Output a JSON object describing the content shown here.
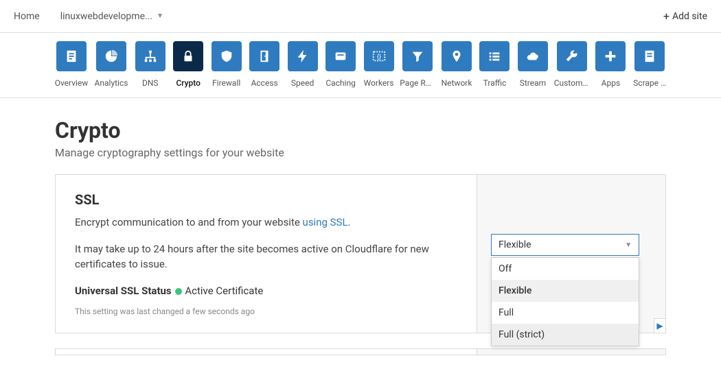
{
  "topbar": {
    "home": "Home",
    "site": "linuxwebdevelopme...",
    "add_site": "Add site"
  },
  "nav": [
    {
      "id": "overview",
      "label": "Overview",
      "icon": "doc"
    },
    {
      "id": "analytics",
      "label": "Analytics",
      "icon": "pie"
    },
    {
      "id": "dns",
      "label": "DNS",
      "icon": "tree"
    },
    {
      "id": "crypto",
      "label": "Crypto",
      "icon": "lock",
      "active": true
    },
    {
      "id": "firewall",
      "label": "Firewall",
      "icon": "shield"
    },
    {
      "id": "access",
      "label": "Access",
      "icon": "door"
    },
    {
      "id": "speed",
      "label": "Speed",
      "icon": "bolt"
    },
    {
      "id": "caching",
      "label": "Caching",
      "icon": "layers"
    },
    {
      "id": "workers",
      "label": "Workers",
      "icon": "code"
    },
    {
      "id": "pagerules",
      "label": "Page Ru…",
      "icon": "funnel"
    },
    {
      "id": "network",
      "label": "Network",
      "icon": "pin"
    },
    {
      "id": "traffic",
      "label": "Traffic",
      "icon": "list"
    },
    {
      "id": "stream",
      "label": "Stream",
      "icon": "cloud"
    },
    {
      "id": "custom",
      "label": "Custom …",
      "icon": "wrench"
    },
    {
      "id": "apps",
      "label": "Apps",
      "icon": "plus"
    },
    {
      "id": "scrape",
      "label": "Scrape …",
      "icon": "page"
    }
  ],
  "page": {
    "title": "Crypto",
    "subtitle": "Manage cryptography settings for your website"
  },
  "ssl_card": {
    "title": "SSL",
    "desc_pre": "Encrypt communication to and from your website ",
    "desc_link": "using SSL",
    "desc_post": ".",
    "note": "It may take up to 24 hours after the site becomes active on Cloudflare for new certificates to issue.",
    "status_label": "Universal SSL Status",
    "status_value": "Active Certificate",
    "last_changed": "This setting was last changed a few seconds ago",
    "selected": "Flexible",
    "options": [
      "Off",
      "Flexible",
      "Full",
      "Full (strict)"
    ]
  }
}
